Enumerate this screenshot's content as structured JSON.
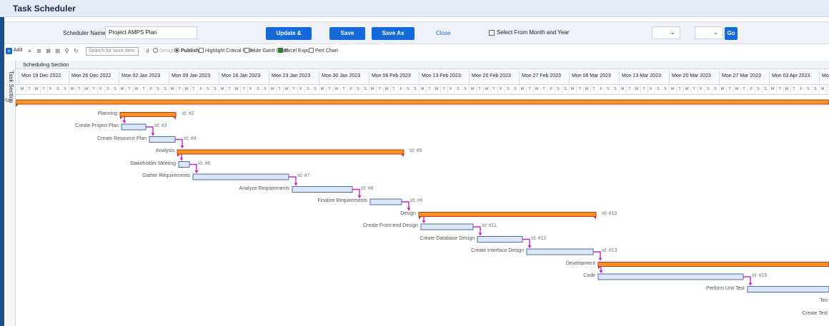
{
  "window": {
    "title": "Task Scheduler"
  },
  "form": {
    "name_label": "Scheduler Name:",
    "required_mark": "*",
    "name_value": "Project AMPS Plan",
    "buttons": {
      "update": "Update & Continue",
      "save_baseline": "Save Baseline",
      "save_template": "Save As Template"
    },
    "close": "Close",
    "select_month_label": "Select From Month and Year",
    "month_value": "",
    "year_value": "",
    "go": "Go"
  },
  "toolbar": {
    "add": "Add",
    "search_placeholder": "Search for work item",
    "design": "Design",
    "publish": "Publish",
    "highlight": "Highlight Critical Path",
    "hide_gantt": "Hide Gantt Chart",
    "excel": "Excel Export",
    "pert": "Pert Chart"
  },
  "side_tab": "Task Section",
  "section_title": "Scheduling Section",
  "weeks": [
    "Mon 19 Dec 2022",
    "Mon 26 Dec 2022",
    "Mon 02 Jan 2023",
    "Mon 09 Jan 2023",
    "Mon 16 Jan 2023",
    "Mon 23 Jan 2023",
    "Mon 30 Jan 2023",
    "Mon 06 Feb 2023",
    "Mon 13 Feb 2023",
    "Mon 20 Feb 2023",
    "Mon 27 Feb 2023",
    "Mon 06 Mar 2023",
    "Mon 13 Mar 2023",
    "Mon 20 Mar 2023",
    "Mon 27 Mar 2023",
    "Mon 03 Apr 2023",
    "Mon"
  ],
  "day_letters": [
    "M",
    "T",
    "W",
    "T",
    "F",
    "S",
    "S"
  ],
  "colors": {
    "summary_fill": "#f7941d",
    "summary_stroke": "#c0392b",
    "task_fill": "#dde6f4",
    "task_stroke": "#4a6fa5",
    "link": "#d020c8",
    "accent": "#1669d9"
  },
  "tasks": [
    {
      "name": "Project AMPS Plan",
      "type": "summary",
      "start": 18,
      "end": 1160,
      "id": ""
    },
    {
      "name": "Planning",
      "type": "summary",
      "start": 168,
      "end": 246,
      "id": "Id: #2"
    },
    {
      "name": "Create Project Plan",
      "type": "task",
      "start": 170,
      "end": 204,
      "id": "Id: #3"
    },
    {
      "name": "Create Resource Plan",
      "type": "task",
      "start": 209,
      "end": 245,
      "id": "Id: #4"
    },
    {
      "name": "Analysis",
      "type": "summary",
      "start": 248,
      "end": 565,
      "id": "Id: #5"
    },
    {
      "name": "Stakeholder Meeting",
      "type": "task",
      "start": 250,
      "end": 265,
      "id": "Id: #6"
    },
    {
      "name": "Gather Requirements",
      "type": "task",
      "start": 270,
      "end": 404,
      "id": "Id: #7"
    },
    {
      "name": "Analyze Requirements",
      "type": "task",
      "start": 409,
      "end": 493,
      "id": "Id: #8"
    },
    {
      "name": "Finalize Requirements",
      "type": "task",
      "start": 518,
      "end": 562,
      "id": "Id: #9"
    },
    {
      "name": "Design",
      "type": "summary",
      "start": 586,
      "end": 834,
      "id": "Id: #10"
    },
    {
      "name": "Create Front-end Design",
      "type": "task",
      "start": 589,
      "end": 662,
      "id": "Id: #11"
    },
    {
      "name": "Create Database Design",
      "type": "task",
      "start": 668,
      "end": 731,
      "id": "Id: #12"
    },
    {
      "name": "Create Interface Design",
      "type": "task",
      "start": 737,
      "end": 830,
      "id": "Id: #13"
    },
    {
      "name": "Development",
      "type": "summary",
      "start": 837,
      "end": 1160,
      "id": ""
    },
    {
      "name": "Code",
      "type": "task",
      "start": 837,
      "end": 1040,
      "id": "Id: #15"
    },
    {
      "name": "Perform Unit Test",
      "type": "task",
      "start": 1046,
      "end": 1160,
      "id": ""
    },
    {
      "name": "Tes",
      "type": "none",
      "start": 0,
      "end": 0,
      "id": ""
    },
    {
      "name": "Create Test",
      "type": "none",
      "start": 0,
      "end": 0,
      "id": ""
    }
  ]
}
